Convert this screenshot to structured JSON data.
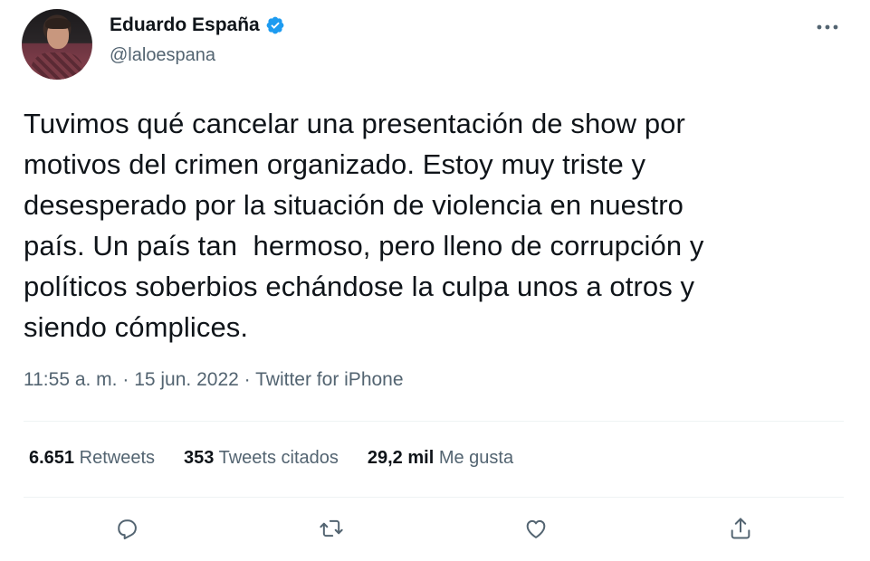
{
  "author": {
    "display_name": "Eduardo España",
    "handle": "@laloespana",
    "verified": true,
    "verified_color": "#1d9bf0"
  },
  "tweet": {
    "text": "Tuvimos qué cancelar una presentación de show por\nmotivos del crimen organizado. Estoy muy triste y\ndesesperado por la situación de violencia en nuestro\npaís. Un país tan  hermoso, pero lleno de corrupción y\npolíticos soberbios echándose la culpa unos a otros y\nsiendo cómplices.",
    "time": "11:55 a. m.",
    "separator": "·",
    "date": "15 jun. 2022",
    "source": "Twitter for iPhone"
  },
  "stats": {
    "retweets_count": "6.651",
    "retweets_label": "Retweets",
    "quotes_count": "353",
    "quotes_label": "Tweets citados",
    "likes_count": "29,2 mil",
    "likes_label": "Me gusta"
  },
  "icons": {
    "more": "more-horizontal-icon",
    "reply": "reply-icon",
    "retweet": "retweet-icon",
    "like": "heart-icon",
    "share": "share-icon"
  },
  "colors": {
    "text": "#0f1419",
    "secondary": "#536471",
    "divider": "#eff3f4"
  }
}
